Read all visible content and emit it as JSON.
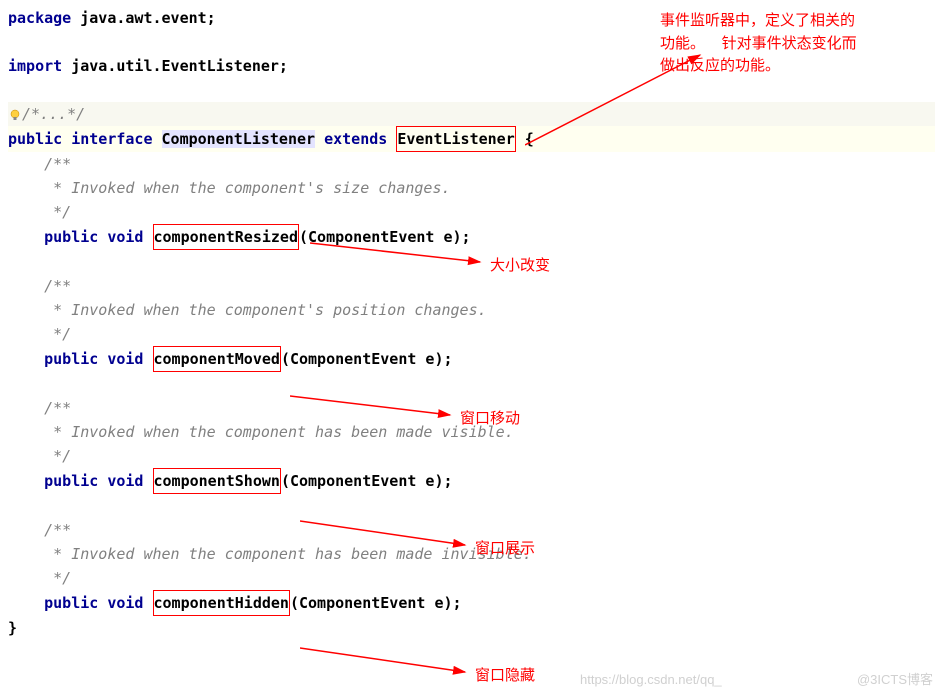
{
  "code": {
    "package_kw": "package",
    "package_name": " java.awt.event;",
    "import_kw": "import",
    "import_name": " java.util.EventListener;",
    "collapsed_comment": "/*...*/",
    "public_kw": "public",
    "interface_kw": "interface",
    "class_name": "ComponentListener",
    "extends_kw": "extends",
    "super_name": "EventListener",
    "brace_open": " {",
    "brace_close": "}",
    "void_kw": "void",
    "method1": {
      "c1": "/**",
      "c2": " * Invoked when the component's size changes.",
      "c3": " */",
      "name": "componentResized",
      "params": "(ComponentEvent e);"
    },
    "method2": {
      "c1": "/**",
      "c2": " * Invoked when the component's position changes.",
      "c3": " */",
      "name": "componentMoved",
      "params": "(ComponentEvent e);"
    },
    "method3": {
      "c1": "/**",
      "c2": " * Invoked when the component has been made visible.",
      "c3": " */",
      "name": "componentShown",
      "params": "(ComponentEvent e);"
    },
    "method4": {
      "c1": "/**",
      "c2": " * Invoked when the component has been made invisible.",
      "c3": " */",
      "name": "componentHidden",
      "params": "(ComponentEvent e);"
    }
  },
  "annotations": {
    "top": "事件监听器中，定义了相关的\n功能。    针对事件状态变化而\n做出反应的功能。",
    "a1": "大小改变",
    "a2": "窗口移动",
    "a3": "窗口展示",
    "a4": "窗口隐藏"
  },
  "watermark": {
    "left": "https://blog.csdn.net/qq_",
    "right": "@3ICTS博客"
  }
}
